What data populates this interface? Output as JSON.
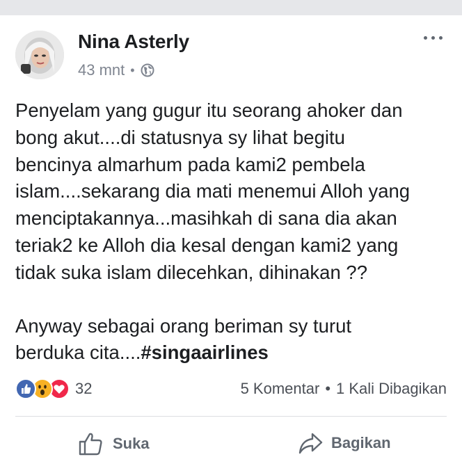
{
  "post": {
    "author": "Nina Asterly",
    "time": "43 mnt",
    "privacy_icon": "globe-icon",
    "text_lines": [
      "Penyelam yang gugur itu seorang ahoker dan",
      "bong akut....di statusnya sy lihat begitu",
      "bencinya almarhum pada kami2 pembela",
      "islam....sekarang dia mati menemui Alloh yang",
      "menciptakannya...masihkah di sana dia akan",
      "teriak2 ke Alloh dia kesal dengan kami2 yang",
      "tidak suka islam dilecehkan, dihinakan ??"
    ],
    "text_line2_prefix": "Anyway sebagai orang beriman sy turut",
    "text_line3_prefix": "berduka cita....",
    "hashtag": "#singaairlines"
  },
  "stats": {
    "reaction_count": "32",
    "comments": "5 Komentar",
    "separator": "•",
    "shares": "1 Kali Dibagikan",
    "reaction_icons": [
      "like-icon",
      "wow-icon",
      "love-icon"
    ]
  },
  "actions": {
    "like_label": "Suka",
    "share_label": "Bagikan"
  },
  "colors": {
    "like_blue": "#4267b2",
    "wow_yellow": "#f7b125",
    "love_red": "#f0284a",
    "muted": "#606770"
  }
}
